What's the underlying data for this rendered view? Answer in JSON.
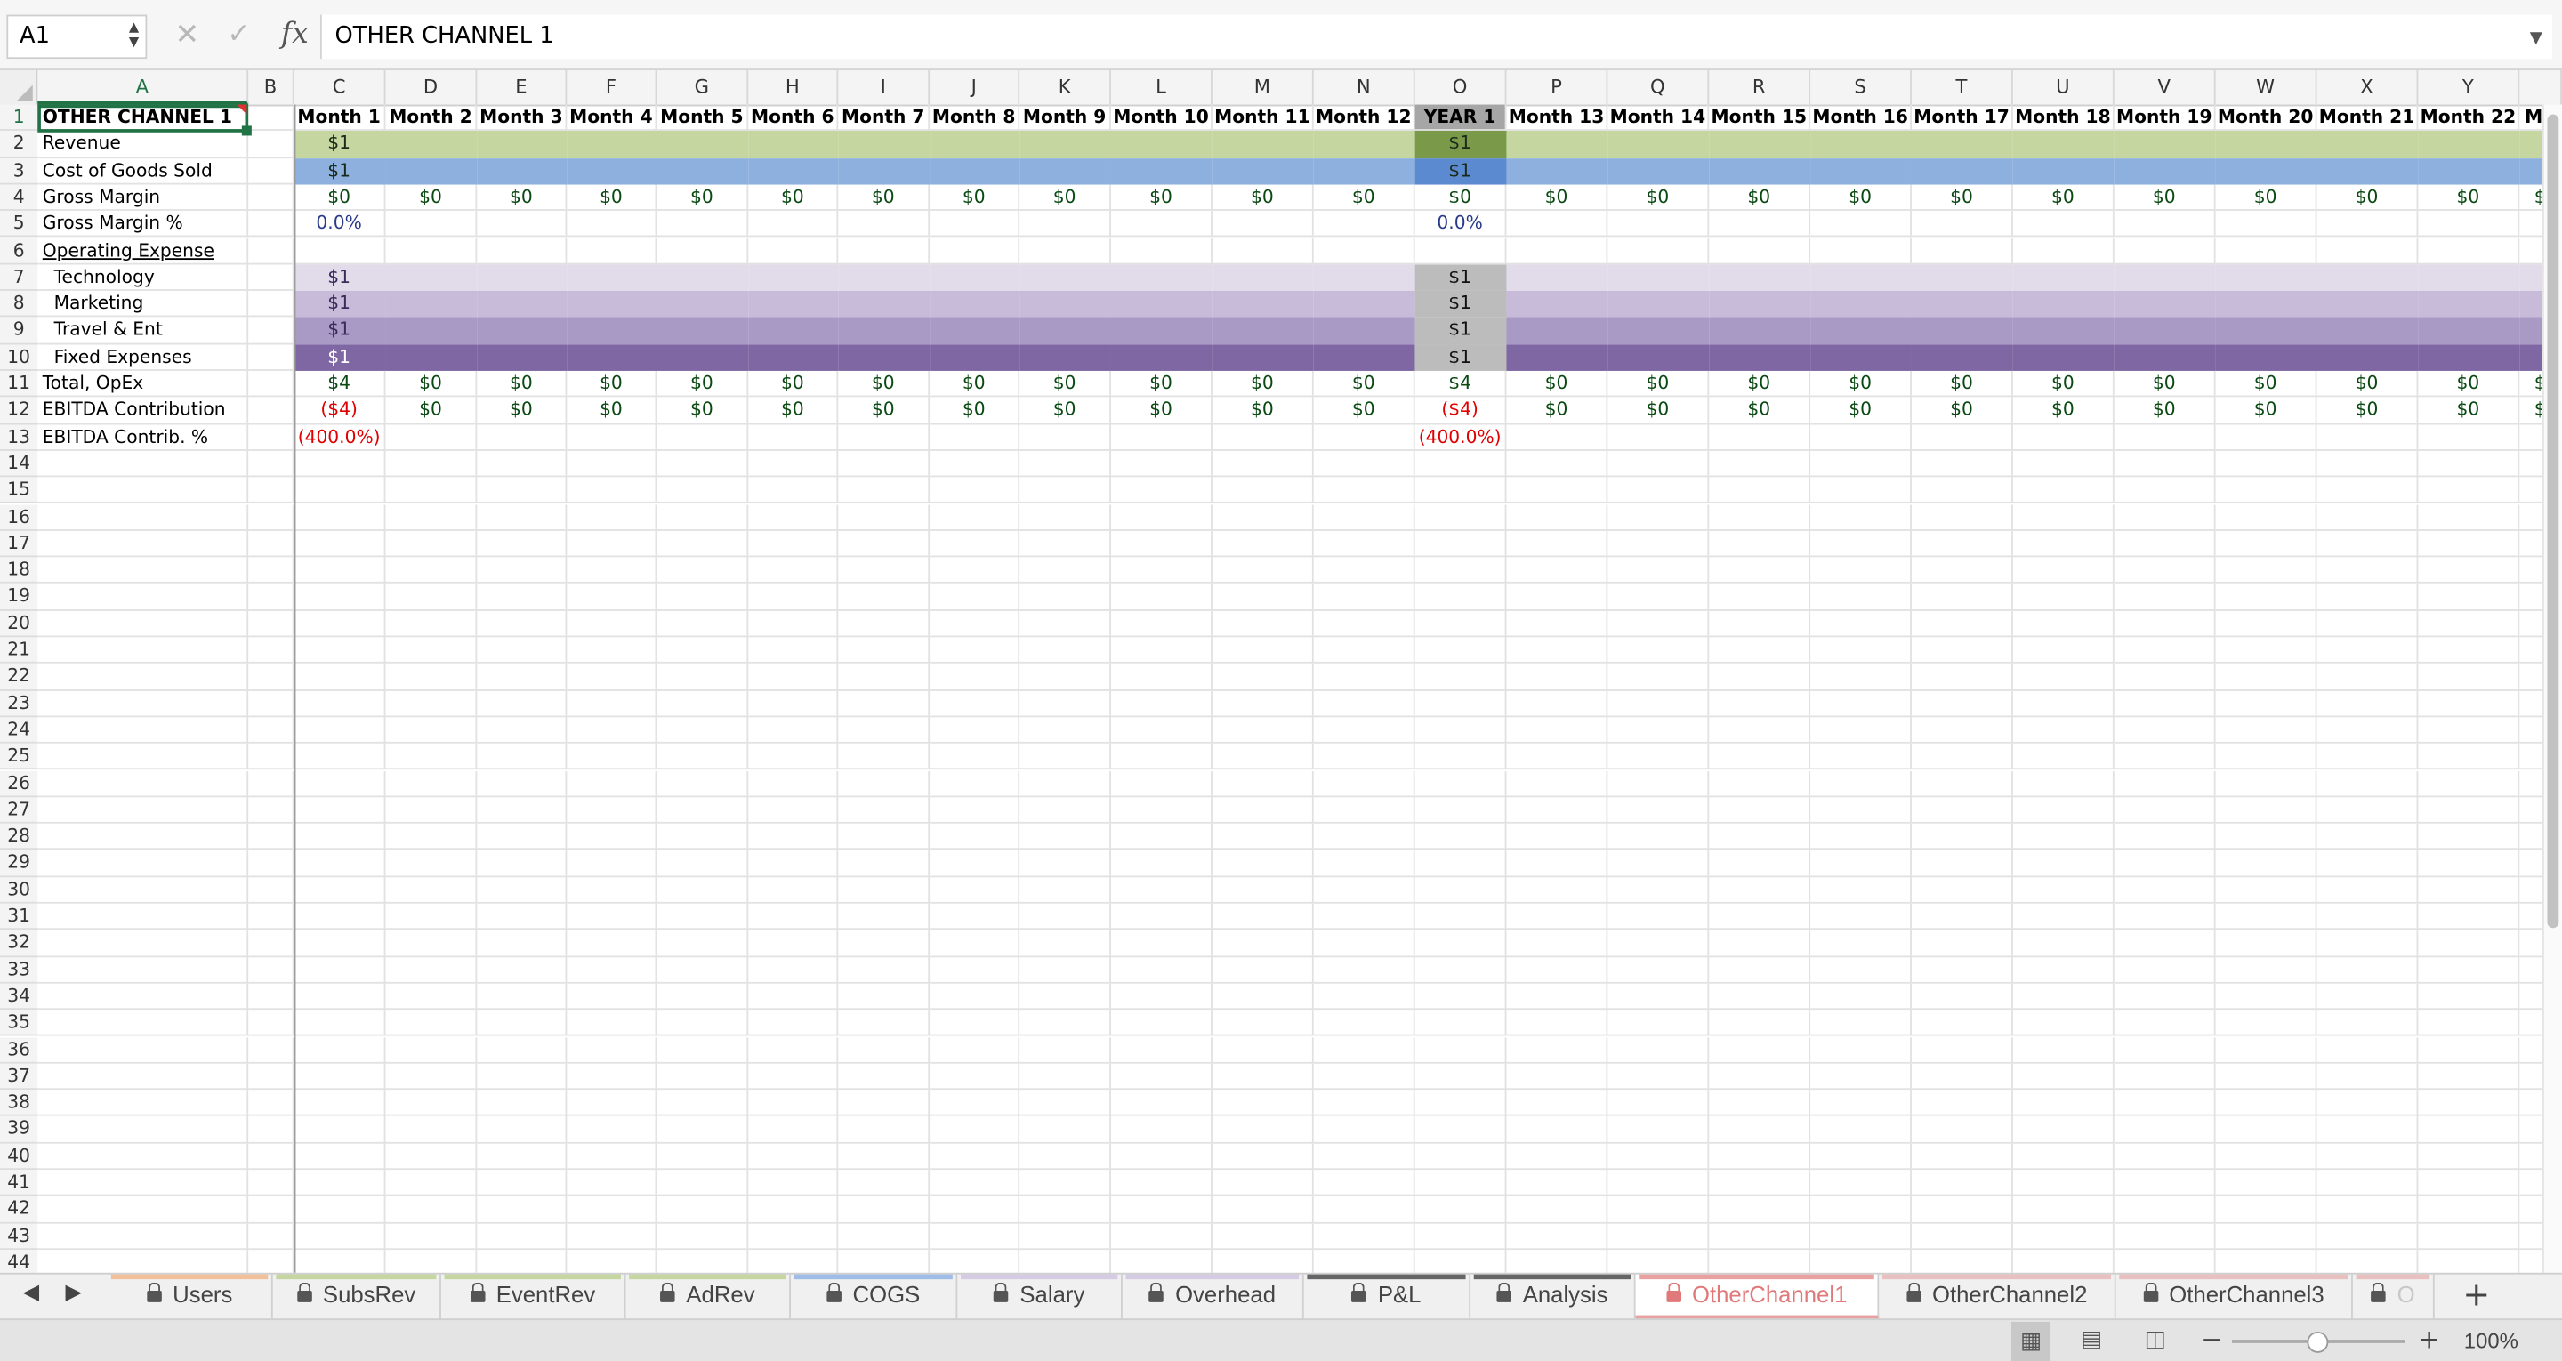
{
  "formula_bar": {
    "name_box": "A1",
    "fx_label": "fx",
    "formula": "OTHER CHANNEL 1"
  },
  "columns": [
    "A",
    "B",
    "C",
    "D",
    "E",
    "F",
    "G",
    "H",
    "I",
    "J",
    "K",
    "L",
    "M",
    "N",
    "O",
    "P",
    "Q",
    "R",
    "S",
    "T",
    "U",
    "V",
    "W",
    "X",
    "Y",
    ""
  ],
  "row_numbers": [
    "1",
    "2",
    "3",
    "4",
    "5",
    "6",
    "7",
    "8",
    "9",
    "10",
    "11",
    "12",
    "13",
    "14",
    "15",
    "16",
    "17",
    "18",
    "19",
    "20",
    "21",
    "22",
    "23",
    "24",
    "25",
    "26",
    "27",
    "28",
    "29",
    "30",
    "31",
    "32",
    "33",
    "34",
    "35",
    "36",
    "37",
    "38",
    "39",
    "40",
    "41",
    "42",
    "43",
    "44"
  ],
  "sheet": {
    "header_row": [
      "Month 1",
      "Month 2",
      "Month 3",
      "Month 4",
      "Month 5",
      "Month 6",
      "Month 7",
      "Month 8",
      "Month 9",
      "Month 10",
      "Month 11",
      "Month 12",
      "YEAR 1",
      "Month 13",
      "Month 14",
      "Month 15",
      "Month 16",
      "Month 17",
      "Month 18",
      "Month 19",
      "Month 20",
      "Month 21",
      "Month 22",
      "Mo"
    ],
    "title": "OTHER CHANNEL 1",
    "rows": [
      {
        "label": "Revenue",
        "band": "#c5d6a0",
        "year_band": "#7a9a4a",
        "values": [
          "$1",
          "",
          "",
          "",
          "",
          "",
          "",
          "",
          "",
          "",
          "",
          "",
          "$1",
          "",
          "",
          "",
          "",
          "",
          "",
          "",
          "",
          "",
          "",
          ""
        ]
      },
      {
        "label": "Cost of Goods Sold",
        "band": "#8eb0df",
        "year_band": "#5b8ad0",
        "values": [
          "$1",
          "",
          "",
          "",
          "",
          "",
          "",
          "",
          "",
          "",
          "",
          "",
          "$1",
          "",
          "",
          "",
          "",
          "",
          "",
          "",
          "",
          "",
          "",
          ""
        ]
      },
      {
        "label": "Gross Margin",
        "band": "",
        "year_band": "",
        "values": [
          "$0",
          "$0",
          "$0",
          "$0",
          "$0",
          "$0",
          "$0",
          "$0",
          "$0",
          "$0",
          "$0",
          "$0",
          "$0",
          "$0",
          "$0",
          "$0",
          "$0",
          "$0",
          "$0",
          "$0",
          "$0",
          "$0",
          "$0",
          "$"
        ]
      },
      {
        "label": "Gross Margin %",
        "band": "",
        "year_band": "",
        "values": [
          "0.0%",
          "",
          "",
          "",
          "",
          "",
          "",
          "",
          "",
          "",
          "",
          "",
          "0.0%",
          "",
          "",
          "",
          "",
          "",
          "",
          "",
          "",
          "",
          "",
          ""
        ]
      },
      {
        "label": "Operating Expense",
        "band": "",
        "year_band": "",
        "values": [
          "",
          "",
          "",
          "",
          "",
          "",
          "",
          "",
          "",
          "",
          "",
          "",
          "",
          "",
          "",
          "",
          "",
          "",
          "",
          "",
          "",
          "",
          "",
          ""
        ]
      },
      {
        "label": "Technology",
        "band": "#e2dcea",
        "year_band": "#bcbcbc",
        "values": [
          "$1",
          "",
          "",
          "",
          "",
          "",
          "",
          "",
          "",
          "",
          "",
          "",
          "$1",
          "",
          "",
          "",
          "",
          "",
          "",
          "",
          "",
          "",
          "",
          ""
        ]
      },
      {
        "label": "Marketing",
        "band": "#c7bbd9",
        "year_band": "#bcbcbc",
        "values": [
          "$1",
          "",
          "",
          "",
          "",
          "",
          "",
          "",
          "",
          "",
          "",
          "",
          "$1",
          "",
          "",
          "",
          "",
          "",
          "",
          "",
          "",
          "",
          "",
          ""
        ]
      },
      {
        "label": "Travel & Ent",
        "band": "#a899c5",
        "year_band": "#bcbcbc",
        "values": [
          "$1",
          "",
          "",
          "",
          "",
          "",
          "",
          "",
          "",
          "",
          "",
          "",
          "$1",
          "",
          "",
          "",
          "",
          "",
          "",
          "",
          "",
          "",
          "",
          ""
        ]
      },
      {
        "label": "Fixed Expenses",
        "band": "#7e67a3",
        "year_band": "#bcbcbc",
        "values": [
          "$1",
          "",
          "",
          "",
          "",
          "",
          "",
          "",
          "",
          "",
          "",
          "",
          "$1",
          "",
          "",
          "",
          "",
          "",
          "",
          "",
          "",
          "",
          "",
          ""
        ]
      },
      {
        "label": "Total, OpEx",
        "band": "",
        "year_band": "",
        "values": [
          "$4",
          "$0",
          "$0",
          "$0",
          "$0",
          "$0",
          "$0",
          "$0",
          "$0",
          "$0",
          "$0",
          "$0",
          "$4",
          "$0",
          "$0",
          "$0",
          "$0",
          "$0",
          "$0",
          "$0",
          "$0",
          "$0",
          "$0",
          "$"
        ]
      },
      {
        "label": "EBITDA Contribution",
        "band": "",
        "year_band": "",
        "values": [
          "($4)",
          "$0",
          "$0",
          "$0",
          "$0",
          "$0",
          "$0",
          "$0",
          "$0",
          "$0",
          "$0",
          "$0",
          "($4)",
          "$0",
          "$0",
          "$0",
          "$0",
          "$0",
          "$0",
          "$0",
          "$0",
          "$0",
          "$0",
          "$"
        ]
      },
      {
        "label": "EBITDA Contrib. %",
        "band": "",
        "year_band": "",
        "values": [
          "(400.0%)",
          "",
          "",
          "",
          "",
          "",
          "",
          "",
          "",
          "",
          "",
          "",
          "(400.0%)",
          "",
          "",
          "",
          "",
          "",
          "",
          "",
          "",
          "",
          "",
          ""
        ]
      }
    ]
  },
  "tabs": [
    {
      "label": "Users",
      "color": "#f2c09a",
      "active": false
    },
    {
      "label": "SubsRev",
      "color": "#c5d6a0",
      "active": false
    },
    {
      "label": "EventRev",
      "color": "#c5d6a0",
      "active": false
    },
    {
      "label": "AdRev",
      "color": "#c5d6a0",
      "active": false
    },
    {
      "label": "COGS",
      "color": "#9fbde6",
      "active": false
    },
    {
      "label": "Salary",
      "color": "#d5cce4",
      "active": false
    },
    {
      "label": "Overhead",
      "color": "#d5cce4",
      "active": false
    },
    {
      "label": "P&L",
      "color": "#666666",
      "active": false
    },
    {
      "label": "Analysis",
      "color": "#666666",
      "active": false
    },
    {
      "label": "OtherChannel1",
      "color": "#e8a0a0",
      "active": true
    },
    {
      "label": "OtherChannel2",
      "color": "#e8c0c0",
      "active": false
    },
    {
      "label": "OtherChannel3",
      "color": "#e8c0c0",
      "active": false
    },
    {
      "label": "O",
      "color": "#e8c0c0",
      "active": false
    }
  ],
  "status": {
    "zoom": "100%"
  },
  "colors": {
    "accent": "#217346",
    "negative": "#e00000"
  }
}
